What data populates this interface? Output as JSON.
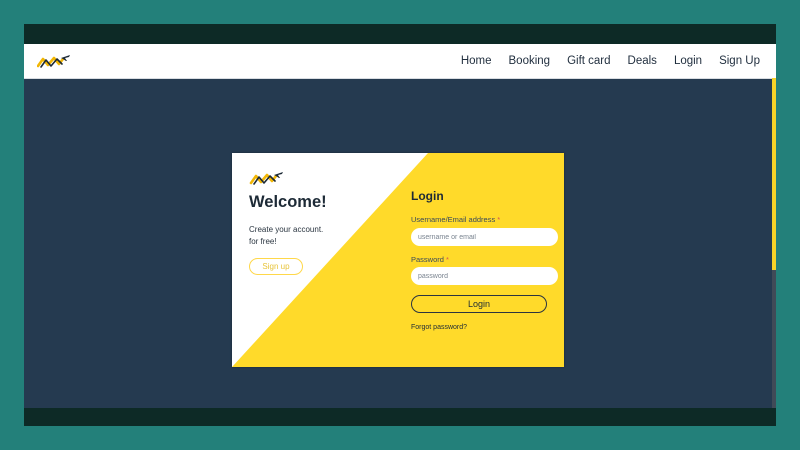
{
  "nav": {
    "links": [
      "Home",
      "Booking",
      "Gift card",
      "Deals",
      "Login",
      "Sign Up"
    ]
  },
  "welcome": {
    "title": "Welcome!",
    "promo_line1": "Create your account.",
    "promo_line2": "for free!",
    "signup_label": "Sign up"
  },
  "login": {
    "title": "Login",
    "username_label": "Username/Email address",
    "username_placeholder": "username or email",
    "password_label": "Password",
    "password_placeholder": "password",
    "required_mark": "*",
    "submit_label": "Login",
    "forgot_label": "Forgot password?"
  },
  "icons": {
    "brand": "airplane-logo-icon"
  },
  "colors": {
    "accent_yellow": "#ffda2a",
    "page_bg": "#253a50",
    "nav_bg": "#ffffff",
    "outer_bg": "#23807a"
  }
}
